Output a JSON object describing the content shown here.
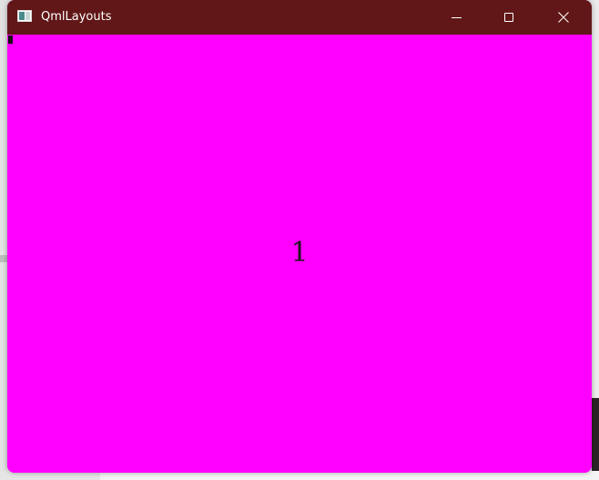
{
  "window": {
    "title": "QmlLayouts",
    "icon": "qt-app-icon",
    "titlebar_color": "#611717",
    "controls": {
      "minimize": "minimize-icon",
      "maximize": "maximize-icon",
      "close": "close-icon"
    }
  },
  "content": {
    "background_color": "#ff00ff",
    "center_text": "1"
  }
}
